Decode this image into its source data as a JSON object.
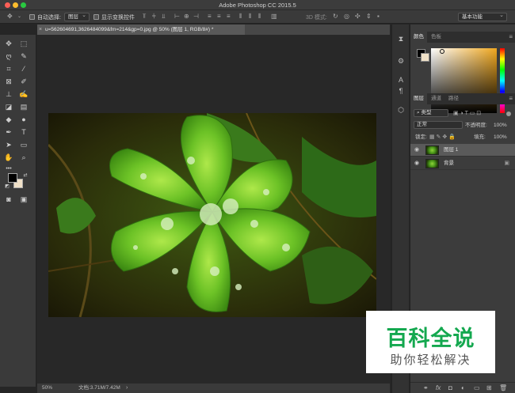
{
  "window": {
    "title": "Adobe Photoshop CC 2015.5"
  },
  "options_bar": {
    "auto_select_label": "自动选择:",
    "auto_select_value": "图层",
    "show_transform_label": "显示变换控件",
    "mode_3d_label": "3D 模式:",
    "workspace": "基本功能"
  },
  "document_tab": {
    "title": "u=562604691,3626484099&fm=214&gp=0.jpg @ 50% (图层 1, RGB/8#) *"
  },
  "status_bar": {
    "zoom": "50%",
    "doc_info": "文档:3.71M/7.42M"
  },
  "color_panel": {
    "tabs": [
      "颜色",
      "色板"
    ],
    "foreground": "#000000",
    "background": "#f0e1c8"
  },
  "layers_panel": {
    "tabs": [
      "图层",
      "通道",
      "路径"
    ],
    "filter_kind": "类型",
    "blend_mode": "正常",
    "opacity_label": "不透明度:",
    "opacity_value": "100%",
    "lock_label": "锁定:",
    "fill_label": "填充:",
    "fill_value": "100%",
    "layers": [
      {
        "name": "图层 1"
      },
      {
        "name": "背景"
      }
    ]
  },
  "watermark": {
    "title": "百科全说",
    "subtitle": "助你轻松解决"
  }
}
